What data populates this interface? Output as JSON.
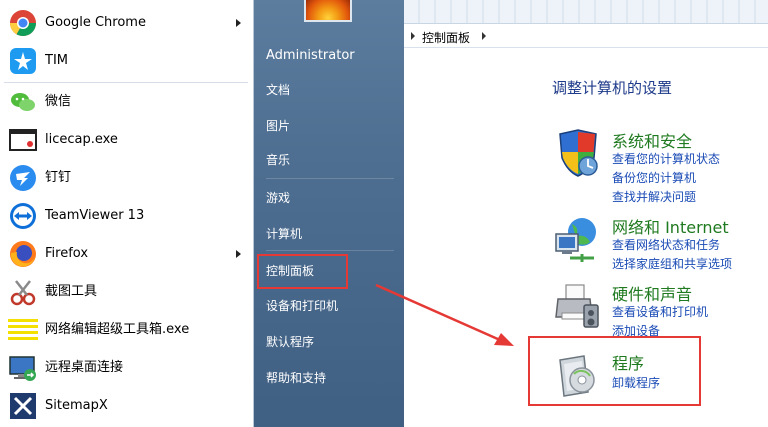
{
  "start_menu": {
    "programs": [
      {
        "label": "Google Chrome",
        "icon": "chrome-icon",
        "has_submenu": true
      },
      {
        "label": "TIM",
        "icon": "tim-icon",
        "has_submenu": false
      },
      {
        "label": "微信",
        "icon": "wechat-icon",
        "has_submenu": false
      },
      {
        "label": "licecap.exe",
        "icon": "licecap-icon",
        "has_submenu": false
      },
      {
        "label": "钉钉",
        "icon": "dingtalk-icon",
        "has_submenu": false
      },
      {
        "label": "TeamViewer 13",
        "icon": "teamviewer-icon",
        "has_submenu": false
      },
      {
        "label": "Firefox",
        "icon": "firefox-icon",
        "has_submenu": true
      },
      {
        "label": "截图工具",
        "icon": "snipping-tool-icon",
        "has_submenu": false
      },
      {
        "label": "网络编辑超级工具箱.exe",
        "icon": "toolbox-icon",
        "has_submenu": false
      },
      {
        "label": "远程桌面连接",
        "icon": "remote-desktop-icon",
        "has_submenu": false
      },
      {
        "label": "SitemapX",
        "icon": "sitemapx-icon",
        "has_submenu": false
      }
    ],
    "places": [
      "Administrator",
      "文档",
      "图片",
      "音乐",
      "游戏",
      "计算机",
      "控制面板",
      "设备和打印机",
      "默认程序",
      "帮助和支持"
    ]
  },
  "control_panel": {
    "breadcrumb": "控制面板",
    "heading": "调整计算机的设置",
    "categories": [
      {
        "title": "系统和安全",
        "icon": "shield-icon",
        "links": [
          "查看您的计算机状态",
          "备份您的计算机",
          "查找并解决问题"
        ]
      },
      {
        "title": "网络和 Internet",
        "icon": "network-icon",
        "links": [
          "查看网络状态和任务",
          "选择家庭组和共享选项"
        ]
      },
      {
        "title": "硬件和声音",
        "icon": "printer-icon",
        "links": [
          "查看设备和打印机",
          "添加设备"
        ]
      },
      {
        "title": "程序",
        "icon": "programs-icon",
        "links": [
          "卸载程序"
        ]
      }
    ]
  },
  "colors": {
    "highlight_border": "#e53935",
    "category_title": "#1f7a1f",
    "link": "#1a4bb5",
    "heading": "#1e3a8a"
  }
}
